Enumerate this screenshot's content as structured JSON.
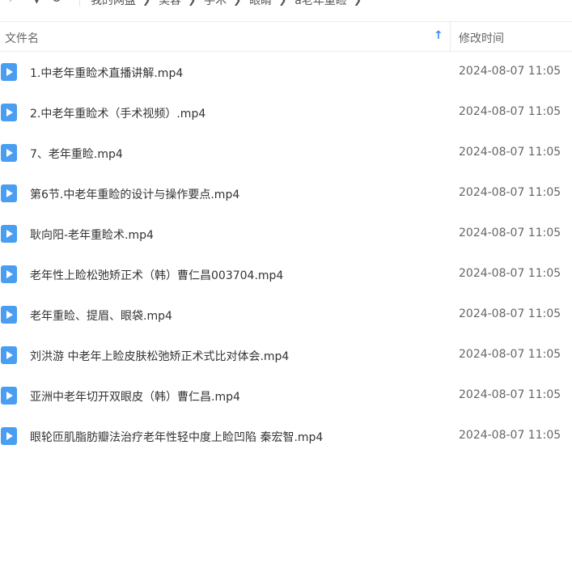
{
  "colors": {
    "accent": "#3b8cf0",
    "video_icon": "#4a9ef2",
    "text": "#333333",
    "muted": "#666666"
  },
  "breadcrumb": [
    "我的网盘",
    "美容",
    "手术",
    "眼睛",
    "a老年重睑"
  ],
  "header": {
    "name_label": "文件名",
    "mtime_label": "修改时间",
    "sort_icon": "arrow-up-icon"
  },
  "files": [
    {
      "name": "1.中老年重睑术直播讲解.mp4",
      "mtime": "2024-08-07 11:05",
      "icon": "video-file-icon"
    },
    {
      "name": "2.中老年重睑术（手术视频）.mp4",
      "mtime": "2024-08-07 11:05",
      "icon": "video-file-icon"
    },
    {
      "name": "7、老年重睑.mp4",
      "mtime": "2024-08-07 11:05",
      "icon": "video-file-icon"
    },
    {
      "name": "第6节.中老年重睑的设计与操作要点.mp4",
      "mtime": "2024-08-07 11:05",
      "icon": "video-file-icon"
    },
    {
      "name": "耿向阳-老年重睑术.mp4",
      "mtime": "2024-08-07 11:05",
      "icon": "video-file-icon"
    },
    {
      "name": "老年性上睑松弛矫正术（韩）曹仁昌003704.mp4",
      "mtime": "2024-08-07 11:05",
      "icon": "video-file-icon"
    },
    {
      "name": "老年重睑、提眉、眼袋.mp4",
      "mtime": "2024-08-07 11:05",
      "icon": "video-file-icon"
    },
    {
      "name": "刘洪游 中老年上睑皮肤松弛矫正术式比对体会.mp4",
      "mtime": "2024-08-07 11:05",
      "icon": "video-file-icon"
    },
    {
      "name": "亚洲中老年切开双眼皮（韩）曹仁昌.mp4",
      "mtime": "2024-08-07 11:05",
      "icon": "video-file-icon"
    },
    {
      "name": "眼轮匝肌脂肪瓣法治疗老年性轻中度上睑凹陷 秦宏智.mp4",
      "mtime": "2024-08-07 11:05",
      "icon": "video-file-icon"
    }
  ]
}
